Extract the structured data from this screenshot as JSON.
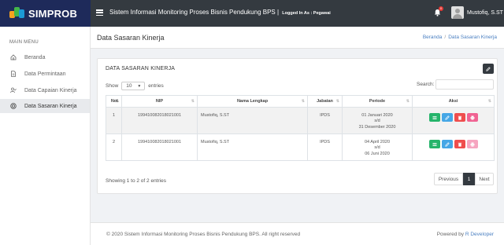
{
  "brand": {
    "name": "SIMPROB"
  },
  "header": {
    "title": "Sistem Informasi Monitoring Proses Bisnis Pendukung BPS |",
    "logged_in": "Logged In As : Pegawai",
    "notification_count": "0",
    "user_name": "Mustofiq, S.ST"
  },
  "sidebar": {
    "menu_title": "MAIN MENU",
    "items": [
      {
        "label": "Beranda",
        "icon": "home-icon"
      },
      {
        "label": "Data Permintaan",
        "icon": "file-icon"
      },
      {
        "label": "Data Capaian Kinerja",
        "icon": "user-check-icon"
      },
      {
        "label": "Data Sasaran Kinerja",
        "icon": "target-icon"
      }
    ]
  },
  "page": {
    "title": "Data Sasaran Kinerja",
    "breadcrumb": [
      "Beranda",
      "/",
      "Data Sasaran Kinerja"
    ]
  },
  "card": {
    "title": "DATA SASARAN KINERJA",
    "show_label": "Show",
    "entries_value": "10",
    "entries_label": "entries",
    "search_label": "Search:",
    "search_value": ""
  },
  "table": {
    "headers": [
      "No",
      "NIP",
      "Nama Lengkap",
      "Jabatan",
      "Periode",
      "Aksi"
    ],
    "rows": [
      {
        "no": "1",
        "nip": "199410082018021001",
        "nama": "Mustofiq, S.ST",
        "jabatan": "IPDS",
        "periode": [
          "01 Januari 2020",
          "s/d",
          "31 Desember 2020"
        ]
      },
      {
        "no": "2",
        "nip": "199410082018021001",
        "nama": "Mustofiq, S.ST",
        "jabatan": "IPDS",
        "periode": [
          "04 April 2020",
          "s/d",
          "06 Juni 2020"
        ]
      }
    ]
  },
  "pagination": {
    "info": "Showing 1 to 2 of 2 entries",
    "previous": "Previous",
    "current": "1",
    "next": "Next"
  },
  "footer": {
    "copyright": "© 2020 Sistem Informasi Monitoring Proses Bisnis Pendukung BPS. All right reserved",
    "powered_by": "Powered by",
    "developer": "R Developer"
  },
  "colors": {
    "view": "#26b46b",
    "edit": "#45a7e6",
    "delete": "#ef4d4d",
    "print": "#f06292",
    "print_disabled": "#f6a5c0"
  }
}
